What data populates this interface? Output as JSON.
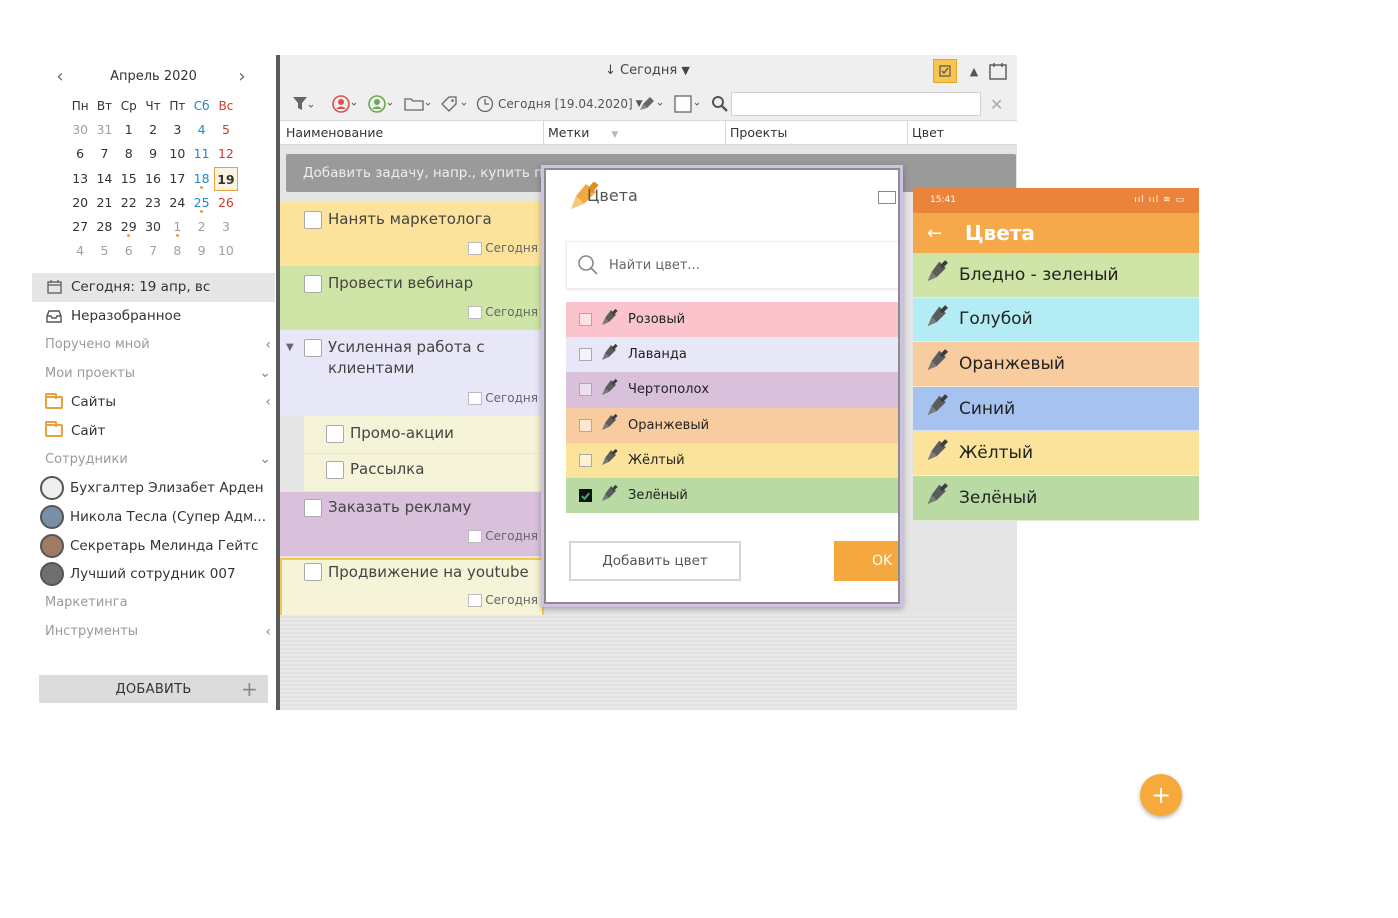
{
  "calendar": {
    "title": "Апрель 2020",
    "prev": "‹",
    "next": "›",
    "weekdays": [
      "Пн",
      "Вт",
      "Ср",
      "Чт",
      "Пт",
      "Сб",
      "Вс"
    ],
    "weeks": [
      [
        "30",
        "31",
        "1",
        "2",
        "3",
        "4",
        "5"
      ],
      [
        "6",
        "7",
        "8",
        "9",
        "10",
        "11",
        "12"
      ],
      [
        "13",
        "14",
        "15",
        "16",
        "17",
        "18",
        "19"
      ],
      [
        "20",
        "21",
        "22",
        "23",
        "24",
        "25",
        "26"
      ],
      [
        "27",
        "28",
        "29",
        "30",
        "1",
        "2",
        "3"
      ],
      [
        "4",
        "5",
        "6",
        "7",
        "8",
        "9",
        "10"
      ]
    ]
  },
  "sidebar": {
    "today": "Сегодня: 19 апр, вс",
    "inbox": "Неразобранное",
    "assigned": "Поручено мной",
    "my_projects": "Мои проекты",
    "proj1": "Сайты",
    "proj2": "Сайт",
    "employees": "Сотрудники",
    "emp1": "Бухгалтер Элизабет Арден",
    "emp2": "Никола Тесла (Супер Адм...",
    "emp3": "Секретарь Мелинда Гейтс",
    "emp4": "Лучший сотрудник 007",
    "marketing": "Маркетинга",
    "tools": "Инструменты",
    "add": "ДОБАВИТЬ"
  },
  "toolbar": {
    "sort": "↓ Сегодня",
    "date_filter": "Сегодня [19.04.2020]"
  },
  "columns": {
    "name": "Наименование",
    "tags": "Метки",
    "projects": "Проекты",
    "color": "Цвет"
  },
  "tasks": {
    "add_placeholder": "Добавить задачу, напр., купить пода",
    "t1": "Нанять маркетолога",
    "t2": "Провести вебинар",
    "t3": "Усиленная работа с клиентами",
    "t4": "Промо-акции",
    "t5": "Рассылка",
    "t6": "Заказать рекламу",
    "t7": "Продвижение на youtube",
    "due": "Сегодня"
  },
  "dialog": {
    "title": "Цвета",
    "search_placeholder": "Найти цвет...",
    "colors": [
      {
        "name": "Розовый",
        "bg": "#fbc3cc",
        "checked": false
      },
      {
        "name": "Лаванда",
        "bg": "#e7e7f8",
        "checked": false
      },
      {
        "name": "Чертополох",
        "bg": "#d9c1dc",
        "checked": false
      },
      {
        "name": "Оранжевый",
        "bg": "#f8cc9f",
        "checked": false
      },
      {
        "name": "Жёлтый",
        "bg": "#fbe39c",
        "checked": false
      },
      {
        "name": "Зелёный",
        "bg": "#b9dba3",
        "checked": true
      }
    ],
    "add_color": "Добавить цвет",
    "ok": "OK"
  },
  "phone": {
    "time": "15:41",
    "status_icons": "ııl ııl ≋ ▭",
    "title": "Цвета",
    "colors": [
      {
        "name": "Бледно - зеленый",
        "bg": "#cfe5a7"
      },
      {
        "name": "Голубой",
        "bg": "#b3ecf4"
      },
      {
        "name": "Оранжевый",
        "bg": "#f8cc9f"
      },
      {
        "name": "Синий",
        "bg": "#a6c3f0"
      },
      {
        "name": "Жёлтый",
        "bg": "#fbe39c"
      },
      {
        "name": "Зелёный",
        "bg": "#b9dba3"
      }
    ]
  },
  "fab": "+"
}
